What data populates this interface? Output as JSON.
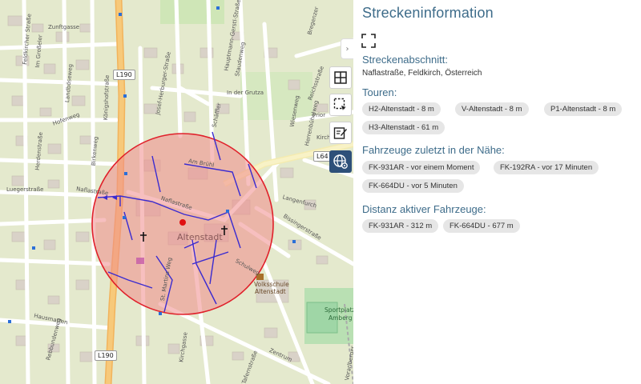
{
  "map": {
    "road_labels": {
      "l190_top": "L190",
      "l190_bottom": "L190",
      "l64": "L64"
    },
    "place_name": "Altenstadt",
    "street_labels": {
      "koenigshofstrasse": "Königshofstraße",
      "naflastrasse": "Naflastraße",
      "naflastr_left": "Naflastraße",
      "luegerstrasse": "Luegerstraße",
      "st_martins_weg": "St. Martins Weg",
      "bissingerstrasse": "Bissingerstraße",
      "schulweg": "Schulweg",
      "langenfurch": "Langenfurch",
      "in_der_grutza": "In der Grutza",
      "herrenbuehelweg": "Herrenbühelweg",
      "am_bruehl": "Am Brühl",
      "josef_herburger": "Josef-Herburger-Straße",
      "kirchgasse": "Kirchgasse",
      "zentrum": "Zentrum",
      "tafernstrasse": "Tafernstraße",
      "rebbundenweg": "Rebbundenweg",
      "hausmatten": "Hausmatten",
      "herdenstrasse": "Herdenstraße",
      "im_grosseler": "Im Großeler",
      "landboeseweg": "Landböseweg",
      "hofenweg": "Hofenweg",
      "birkenweg": "Birkenweg",
      "zunftgasse": "Zunftgasse",
      "feldkircherstr": "Feldkircher Straße",
      "hauptmann": "Hauptmann-Gerstl-Straße",
      "staudenweg": "Staudenweg",
      "schaeffler": "Schäffler",
      "vorarlberg": "Vorarlberger",
      "prior": "Prior",
      "wiesenweg": "Wiesenweg",
      "bregenzerstr": "Bregenzer",
      "kirchweg": "Kirchweg",
      "reichsstr": "Reichsstraße"
    },
    "poi_labels": {
      "volksschule_line1": "Volksschule",
      "volksschule_line2": "Altenstadt",
      "sportplatz_line1": "Sportplatz",
      "sportplatz_line2": "Amberg"
    },
    "collapse_icon": "chevron-right-icon",
    "tools": [
      {
        "name": "grid-icon"
      },
      {
        "name": "select-area-icon"
      },
      {
        "name": "edit-icon"
      },
      {
        "name": "globe-settings-icon"
      }
    ]
  },
  "panel": {
    "title": "Streckeninformation",
    "fullscreen_icon": "fullscreen-icon",
    "section_label": "Streckenabschnitt:",
    "section_value": "Naflastraße, Feldkirch, Österreich",
    "tours_label": "Touren:",
    "tours": [
      "H2-Altenstadt - 8 m",
      "V-Altenstadt - 8 m",
      "P1-Altenstadt - 8 m",
      "H3-Altenstadt - 61 m"
    ],
    "vehicles_label": "Fahrzeuge zuletzt in der Nähe:",
    "vehicles": [
      "FK-931AR - vor einem Moment",
      "FK-192RA - vor 17 Minuten",
      "FK-664DU - vor 5 Minuten"
    ],
    "distance_label": "Distanz aktiver Fahrzeuge:",
    "distances": [
      "FK-931AR - 312 m",
      "FK-664DU - 677 m"
    ]
  },
  "colors": {
    "accent": "#3e6c8a",
    "active_tool": "#2e5079",
    "circle_stroke": "#e0202a",
    "circle_fill": "#f08a8a",
    "route": "#3a2bd0",
    "chip_bg": "#e6e6e6"
  }
}
